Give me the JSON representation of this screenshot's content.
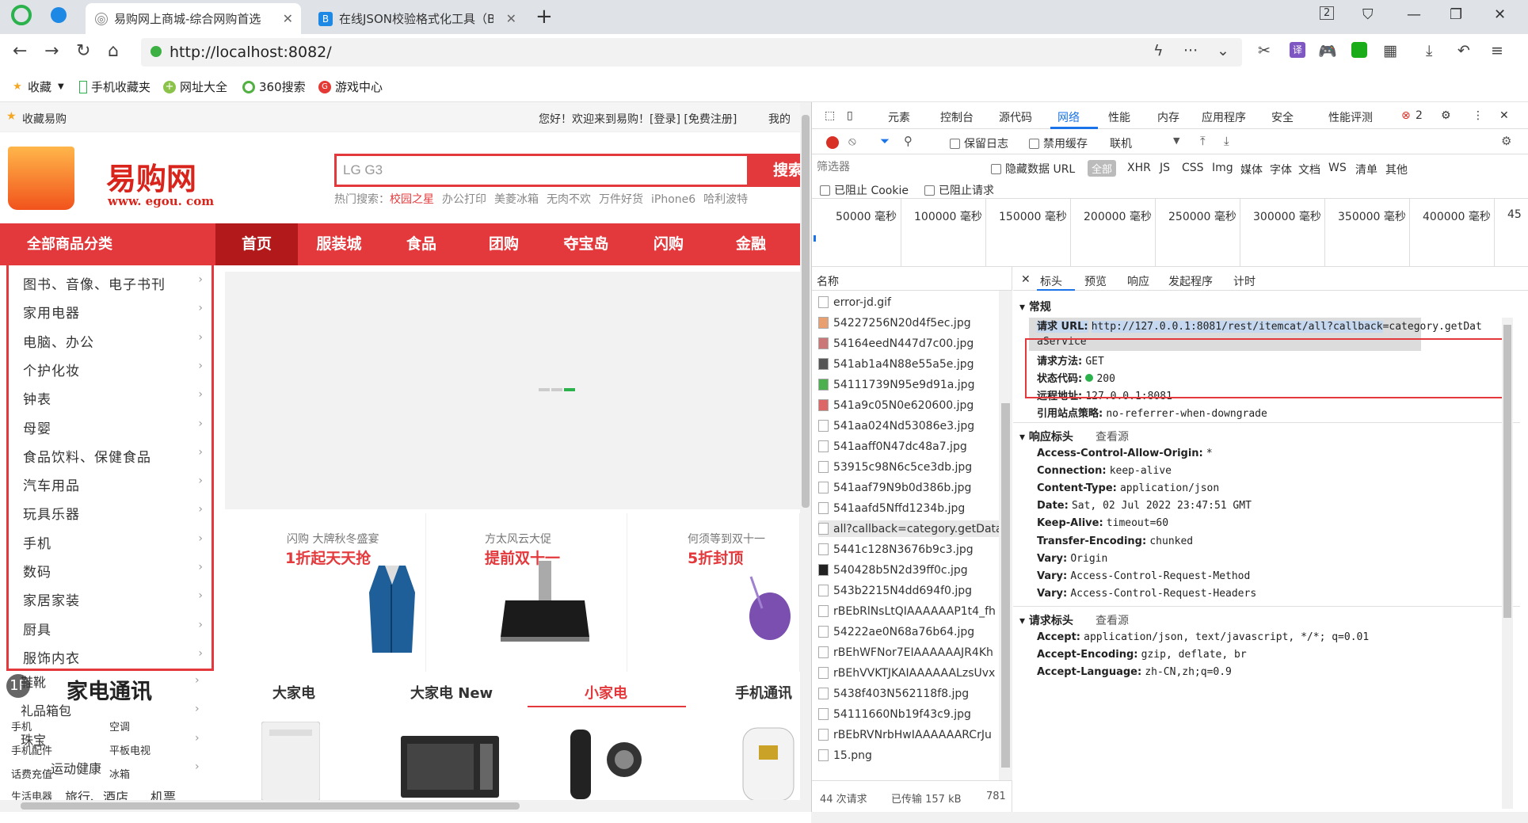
{
  "browser": {
    "tabs": [
      {
        "title": "易购网上商城-综合网购首选"
      },
      {
        "title": "在线JSON校验格式化工具（B"
      }
    ],
    "new_tab": "+",
    "tab_count": "2",
    "url": "http://localhost:8082/",
    "url_host": "localhost",
    "bookmarks": [
      "收藏",
      "手机收藏夹",
      "网址大全",
      "360搜索",
      "游戏中心"
    ]
  },
  "site": {
    "top_left": "收藏易购",
    "top_right": "您好！欢迎来到易购！[登录] [免费注册]",
    "top_mine": "我的",
    "logo_text": "易购网",
    "logo_url": "www. egou. com",
    "search_value": "LG G3",
    "search_btn": "搜索",
    "hot_label": "热门搜索：",
    "hot": [
      "校园之星",
      "办公打印",
      "美菱冰箱",
      "无肉不欢",
      "万件好货",
      "iPhone6",
      "哈利波特"
    ],
    "all_categories": "全部商品分类",
    "nav": [
      "首页",
      "服装城",
      "食品",
      "团购",
      "夺宝岛",
      "闪购",
      "金融"
    ],
    "categories": [
      "图书、音像、电子书刊",
      "家用电器",
      "电脑、办公",
      "个护化妆",
      "钟表",
      "母婴",
      "食品饮料、保健食品",
      "汽车用品",
      "玩具乐器",
      "手机",
      "数码",
      "家居家装",
      "厨具",
      "服饰内衣"
    ],
    "more_categories": [
      "鞋靴",
      "礼品箱包",
      "珠宝",
      "运动健康",
      "旅行、酒店",
      "机票"
    ],
    "promos": [
      {
        "line1": "闪购  大牌秋冬盛宴",
        "line2": "1折起天天抢"
      },
      {
        "line1": "方太风云大促",
        "line2": "提前双十一"
      },
      {
        "line1": "何须等到双十一",
        "line2": "5折封顶"
      }
    ],
    "floor_num": "1F",
    "floor_title": "家电通讯",
    "floor_tabs": [
      "大家电",
      "大家电 New",
      "小家电",
      "手机通讯"
    ],
    "floor_sub": [
      "手机",
      "空调",
      "手机配件",
      "平板电视",
      "话费充值",
      "冰箱",
      "生活电器"
    ]
  },
  "devtools": {
    "tabs": [
      "元素",
      "控制台",
      "源代码",
      "网络",
      "性能",
      "内存",
      "应用程序",
      "安全",
      "性能评测"
    ],
    "error_count": "2",
    "preserve_log": "保留日志",
    "disable_cache": "禁用缓存",
    "online": "联机",
    "filter_placeholder": "筛选器",
    "hide_data_url": "隐藏数据 URL",
    "types": [
      "全部",
      "XHR",
      "JS",
      "CSS",
      "Img",
      "媒体",
      "字体",
      "文档",
      "WS",
      "清单",
      "其他"
    ],
    "blocked_cookie": "已阻止 Cookie",
    "blocked_req": "已阻止请求",
    "timeline": [
      "50000 毫秒",
      "100000 毫秒",
      "150000 毫秒",
      "200000 毫秒",
      "250000 毫秒",
      "300000 毫秒",
      "350000 毫秒",
      "400000 毫秒",
      "45"
    ],
    "names_header": "名称",
    "requests": [
      "error-jd.gif",
      "54227256N20d4f5ec.jpg",
      "54164eedN447d7c00.jpg",
      "541ab1a4N88e55a5e.jpg",
      "54111739N95e9d91a.jpg",
      "541a9c05N0e620600.jpg",
      "541aa024Nd53086e3.jpg",
      "541aaff0N47dc48a7.jpg",
      "53915c98N6c5ce3db.jpg",
      "541aaf79N9b0d386b.jpg",
      "541aafd5Nffd1234b.jpg",
      "all?callback=category.getData",
      "5441c128N3676b9c3.jpg",
      "540428b5N2d39ff0c.jpg",
      "543b2215N4dd694f0.jpg",
      "rBEbRlNsLtQIAAAAAAP1t4_fh",
      "54222ae0N68a76b64.jpg",
      "rBEhWFNor7EIAAAAAAJR4Kh",
      "rBEhVVKTJKAIAAAAAALzsUvx",
      "5438f403N562118f8.jpg",
      "54111660Nb19f43c9.jpg",
      "rBEbRVNrbHwIAAAAAARCrJu",
      "15.png"
    ],
    "status_requests": "44 次请求",
    "status_transferred": "已传输 157 kB",
    "status_more": "781",
    "detail_tabs": [
      "标头",
      "预览",
      "响应",
      "发起程序",
      "计时"
    ],
    "general": {
      "title": "常规",
      "request_url_label": "请求 URL:",
      "request_url_sel": "http://127.0.0.1:8081/rest/itemcat/all?callback",
      "request_url_rest": "=category.getDat",
      "request_url_wrap": "aService",
      "method_label": "请求方法:",
      "method": "GET",
      "status_label": "状态代码:",
      "status": "200",
      "remote_label": "远程地址:",
      "remote": "127.0.0.1:8081",
      "referrer_label": "引用站点策略:",
      "referrer": "no-referrer-when-downgrade"
    },
    "response_headers": {
      "title": "响应标头",
      "view_source": "查看源",
      "items": [
        {
          "k": "Access-Control-Allow-Origin:",
          "v": "*"
        },
        {
          "k": "Connection:",
          "v": "keep-alive"
        },
        {
          "k": "Content-Type:",
          "v": "application/json"
        },
        {
          "k": "Date:",
          "v": "Sat, 02 Jul 2022 23:47:51 GMT"
        },
        {
          "k": "Keep-Alive:",
          "v": "timeout=60"
        },
        {
          "k": "Transfer-Encoding:",
          "v": "chunked"
        },
        {
          "k": "Vary:",
          "v": "Origin"
        },
        {
          "k": "Vary:",
          "v": "Access-Control-Request-Method"
        },
        {
          "k": "Vary:",
          "v": "Access-Control-Request-Headers"
        }
      ]
    },
    "request_headers": {
      "title": "请求标头",
      "view_source": "查看源",
      "items": [
        {
          "k": "Accept:",
          "v": "application/json, text/javascript, */*; q=0.01"
        },
        {
          "k": "Accept-Encoding:",
          "v": "gzip, deflate, br"
        },
        {
          "k": "Accept-Language:",
          "v": "zh-CN,zh;q=0.9"
        }
      ]
    }
  }
}
